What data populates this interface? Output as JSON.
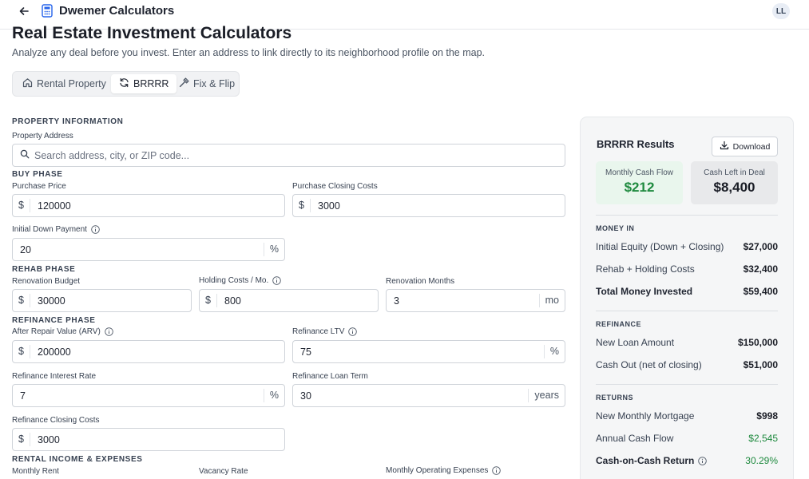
{
  "app": {
    "title": "Dwemer Calculators",
    "avatar_initials": "LL"
  },
  "header": {
    "title": "Real Estate Investment Calculators",
    "subtitle": "Analyze any deal before you invest. Enter an address to link directly to its neighborhood profile on the map."
  },
  "tabs": [
    {
      "label": "Rental Property",
      "icon": "home-icon",
      "active": false
    },
    {
      "label": "BRRRR",
      "icon": "refresh-icon",
      "active": true
    },
    {
      "label": "Fix & Flip",
      "icon": "hammer-icon",
      "active": false
    }
  ],
  "property": {
    "section": "PROPERTY INFORMATION",
    "address_label": "Property Address",
    "address_placeholder": "Search address, city, or ZIP code..."
  },
  "buy": {
    "section": "BUY PHASE",
    "purchase_price_label": "Purchase Price",
    "purchase_price": "120000",
    "closing_label": "Purchase Closing Costs",
    "closing": "3000",
    "down_label": "Initial Down Payment",
    "down": "20"
  },
  "rehab": {
    "section": "REHAB PHASE",
    "budget_label": "Renovation Budget",
    "budget": "30000",
    "holding_label": "Holding Costs / Mo.",
    "holding": "800",
    "months_label": "Renovation Months",
    "months": "3"
  },
  "refinance": {
    "section": "REFINANCE PHASE",
    "arv_label": "After Repair Value (ARV)",
    "arv": "200000",
    "ltv_label": "Refinance LTV",
    "ltv": "75",
    "rate_label": "Refinance Interest Rate",
    "rate": "7",
    "term_label": "Refinance Loan Term",
    "term": "30",
    "closing_label": "Refinance Closing Costs",
    "closing": "3000"
  },
  "rental": {
    "section": "RENTAL INCOME & EXPENSES",
    "rent_label": "Monthly Rent",
    "vacancy_label": "Vacancy Rate",
    "opex_label": "Monthly Operating Expenses"
  },
  "units": {
    "dollar": "$",
    "percent": "%",
    "mo": "mo",
    "years": "years"
  },
  "results": {
    "title": "BRRRR Results",
    "download_label": "Download",
    "kpi_cashflow_label": "Monthly Cash Flow",
    "kpi_cashflow": "$212",
    "kpi_cashleft_label": "Cash Left in Deal",
    "kpi_cashleft": "$8,400",
    "money_in_section": "MONEY IN",
    "equity_label": "Initial Equity (Down + Closing)",
    "equity": "$27,000",
    "rehab_label": "Rehab + Holding Costs",
    "rehab": "$32,400",
    "total_label": "Total Money Invested",
    "total": "$59,400",
    "refi_section": "REFINANCE",
    "loan_label": "New Loan Amount",
    "loan": "$150,000",
    "cashout_label": "Cash Out (net of closing)",
    "cashout": "$51,000",
    "returns_section": "RETURNS",
    "mortgage_label": "New Monthly Mortgage",
    "mortgage": "$998",
    "annual_label": "Annual Cash Flow",
    "annual": "$2,545",
    "coc_label": "Cash-on-Cash Return",
    "coc": "30.29%"
  },
  "colors": {
    "accent_green": "#1f8a3f",
    "kpi_green_bg": "#e9f6ed",
    "panel_bg": "#f5f6f7"
  }
}
